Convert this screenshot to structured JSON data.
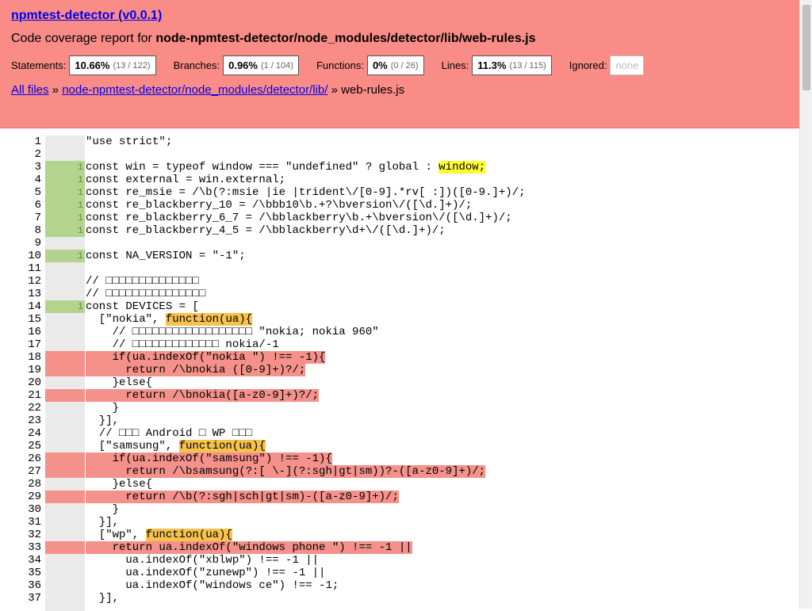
{
  "header": {
    "title": "npmtest-detector (v0.0.1)",
    "subtitle_prefix": "Code coverage report for ",
    "subtitle_path": "node-npmtest-detector/node_modules/detector/lib/web-rules.js",
    "stats": [
      {
        "label": "Statements:",
        "pct": "10.66%",
        "frac": "(13 / 122)"
      },
      {
        "label": "Branches:",
        "pct": "0.96%",
        "frac": "(1 / 104)"
      },
      {
        "label": "Functions:",
        "pct": "0%",
        "frac": "(0 / 26)"
      },
      {
        "label": "Lines:",
        "pct": "11.3%",
        "frac": "(13 / 115)"
      }
    ],
    "ignored_label": "Ignored:",
    "ignored_value": "none",
    "breadcrumb": {
      "all_files": "All files",
      "sep1": " » ",
      "dir": "node-npmtest-detector/node_modules/detector/lib/",
      "sep2": " » ",
      "file": "web-rules.js"
    }
  },
  "code_lines": [
    {
      "n": "1",
      "c": "",
      "s": "",
      "segs": [
        [
          "\"use strict\";",
          ""
        ]
      ]
    },
    {
      "n": "2",
      "c": "",
      "s": "",
      "segs": [
        [
          "",
          ""
        ]
      ]
    },
    {
      "n": "3",
      "c": "1",
      "s": "cov",
      "segs": [
        [
          "const win = typeof window === \"undefined\" ? global : ",
          ""
        ],
        [
          "window;",
          "y"
        ]
      ]
    },
    {
      "n": "4",
      "c": "1",
      "s": "cov",
      "segs": [
        [
          "const external = win.external;",
          ""
        ]
      ]
    },
    {
      "n": "5",
      "c": "1",
      "s": "cov",
      "segs": [
        [
          "const re_msie = /\\b(?:msie |ie |trident\\/[0-9].*rv[ :])([0-9.]+)/;",
          ""
        ]
      ]
    },
    {
      "n": "6",
      "c": "1",
      "s": "cov",
      "segs": [
        [
          "const re_blackberry_10 = /\\bbb10\\b.+?\\bversion\\/([\\d.]+)/;",
          ""
        ]
      ]
    },
    {
      "n": "7",
      "c": "1",
      "s": "cov",
      "segs": [
        [
          "const re_blackberry_6_7 = /\\bblackberry\\b.+\\bversion\\/([\\d.]+)/;",
          ""
        ]
      ]
    },
    {
      "n": "8",
      "c": "1",
      "s": "cov",
      "segs": [
        [
          "const re_blackberry_4_5 = /\\bblackberry\\d+\\/([\\d.]+)/;",
          ""
        ]
      ]
    },
    {
      "n": "9",
      "c": "",
      "s": "",
      "segs": [
        [
          "",
          ""
        ]
      ]
    },
    {
      "n": "10",
      "c": "1",
      "s": "cov",
      "segs": [
        [
          "const NA_VERSION = \"-1\";",
          ""
        ]
      ]
    },
    {
      "n": "11",
      "c": "",
      "s": "",
      "segs": [
        [
          "",
          ""
        ]
      ]
    },
    {
      "n": "12",
      "c": "",
      "s": "",
      "segs": [
        [
          "// □□□□□□□□□□□□□□",
          ""
        ]
      ]
    },
    {
      "n": "13",
      "c": "",
      "s": "",
      "segs": [
        [
          "// □□□□□□□□□□□□□□□",
          ""
        ]
      ]
    },
    {
      "n": "14",
      "c": "1",
      "s": "cov",
      "segs": [
        [
          "const DEVICES = [",
          ""
        ]
      ]
    },
    {
      "n": "15",
      "c": "",
      "s": "",
      "segs": [
        [
          "  [\"nokia\", ",
          ""
        ],
        [
          "function(ua){",
          "o"
        ]
      ]
    },
    {
      "n": "16",
      "c": "",
      "s": "",
      "segs": [
        [
          "    // □□□□□□□□□□□□□□□□□□ \"nokia; nokia 960\"",
          ""
        ]
      ]
    },
    {
      "n": "17",
      "c": "",
      "s": "",
      "segs": [
        [
          "    // □□□□□□□□□□□□□ nokia/-1",
          ""
        ]
      ]
    },
    {
      "n": "18",
      "c": "",
      "s": "unc",
      "segs": [
        [
          "    if(ua.indexOf(\"nokia \") !== -1){",
          "r"
        ]
      ]
    },
    {
      "n": "19",
      "c": "",
      "s": "unc",
      "segs": [
        [
          "      return /\\bnokia ([0-9]+)?/;",
          "r"
        ]
      ]
    },
    {
      "n": "20",
      "c": "",
      "s": "",
      "segs": [
        [
          "    }else{",
          ""
        ]
      ]
    },
    {
      "n": "21",
      "c": "",
      "s": "unc",
      "segs": [
        [
          "      return /\\bnokia([a-z0-9]+)?/;",
          "r"
        ]
      ]
    },
    {
      "n": "22",
      "c": "",
      "s": "",
      "segs": [
        [
          "    }",
          ""
        ]
      ]
    },
    {
      "n": "23",
      "c": "",
      "s": "",
      "segs": [
        [
          "  }],",
          ""
        ]
      ]
    },
    {
      "n": "24",
      "c": "",
      "s": "",
      "segs": [
        [
          "  // □□□ Android □ WP □□□",
          ""
        ]
      ]
    },
    {
      "n": "25",
      "c": "",
      "s": "",
      "segs": [
        [
          "  [\"samsung\", ",
          ""
        ],
        [
          "function(ua){",
          "o"
        ]
      ]
    },
    {
      "n": "26",
      "c": "",
      "s": "unc",
      "segs": [
        [
          "    if(ua.indexOf(\"samsung\") !== -1){",
          "r"
        ]
      ]
    },
    {
      "n": "27",
      "c": "",
      "s": "unc",
      "segs": [
        [
          "      return /\\bsamsung(?:[ \\-](?:sgh|gt|sm))?-([a-z0-9]+)/;",
          "r"
        ]
      ]
    },
    {
      "n": "28",
      "c": "",
      "s": "",
      "segs": [
        [
          "    }else{",
          ""
        ]
      ]
    },
    {
      "n": "29",
      "c": "",
      "s": "unc",
      "segs": [
        [
          "      return /\\b(?:sgh|sch|gt|sm)-([a-z0-9]+)/;",
          "r"
        ]
      ]
    },
    {
      "n": "30",
      "c": "",
      "s": "",
      "segs": [
        [
          "    }",
          ""
        ]
      ]
    },
    {
      "n": "31",
      "c": "",
      "s": "",
      "segs": [
        [
          "  }],",
          ""
        ]
      ]
    },
    {
      "n": "32",
      "c": "",
      "s": "",
      "segs": [
        [
          "  [\"wp\", ",
          ""
        ],
        [
          "function(ua){",
          "o"
        ]
      ]
    },
    {
      "n": "33",
      "c": "",
      "s": "unc",
      "segs": [
        [
          "    return ua.indexOf(\"windows phone \") !== -1 ||",
          "r"
        ]
      ]
    },
    {
      "n": "34",
      "c": "",
      "s": "",
      "segs": [
        [
          "      ua.indexOf(\"xblwp\") !== -1 ||",
          ""
        ]
      ]
    },
    {
      "n": "35",
      "c": "",
      "s": "",
      "segs": [
        [
          "      ua.indexOf(\"zunewp\") !== -1 ||",
          ""
        ]
      ]
    },
    {
      "n": "36",
      "c": "",
      "s": "",
      "segs": [
        [
          "      ua.indexOf(\"windows ce\") !== -1;",
          ""
        ]
      ]
    },
    {
      "n": "37",
      "c": "",
      "s": "",
      "segs": [
        [
          "  }],",
          ""
        ]
      ]
    }
  ]
}
